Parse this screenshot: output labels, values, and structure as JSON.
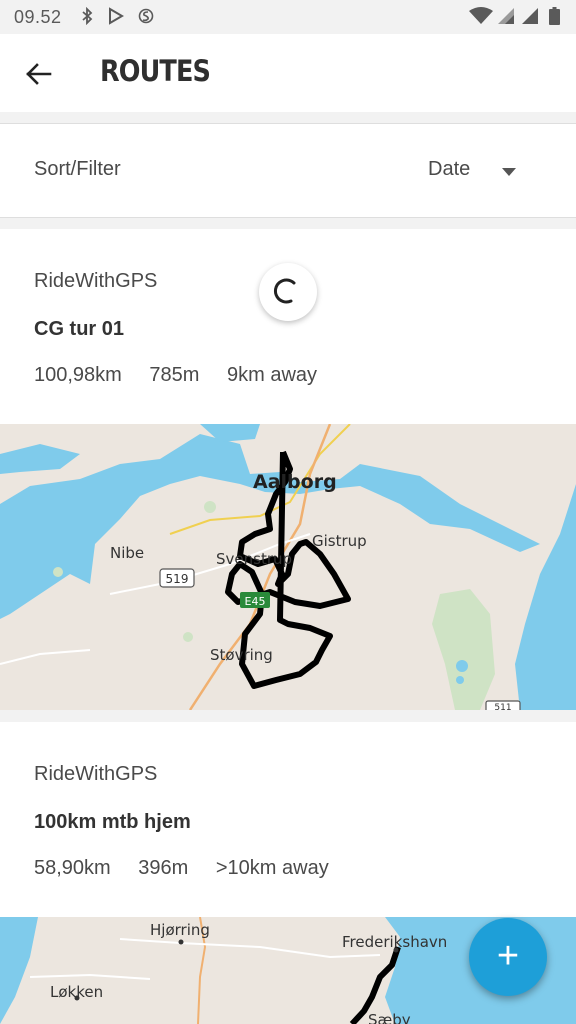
{
  "status_bar": {
    "time": "09.52",
    "icons": [
      "bluetooth-icon",
      "play-store-icon",
      "sync-icon",
      "wifi-icon",
      "signal-icon",
      "signal-icon-2",
      "battery-icon"
    ]
  },
  "app_bar": {
    "title": "ROUTES",
    "back_icon": "arrow-left-icon"
  },
  "sort_filter": {
    "label": "Sort/Filter",
    "selected": "Date"
  },
  "routes": [
    {
      "source": "RideWithGPS",
      "name": "CG tur 01",
      "distance": "100,98km",
      "elevation": "785m",
      "proximity": "9km away",
      "map_labels": [
        "Aalborg",
        "Gistrup",
        "Nibe",
        "Svenstrup",
        "Støvring",
        "519",
        "E45",
        "511"
      ]
    },
    {
      "source": "RideWithGPS",
      "name": "100km mtb hjem",
      "distance": "58,90km",
      "elevation": "396m",
      "proximity": ">10km away",
      "map_labels": [
        "Hjørring",
        "Frederikshavn",
        "Løkken",
        "Sæby"
      ]
    }
  ],
  "fab": {
    "label": "+",
    "icon": "plus-icon"
  },
  "colors": {
    "accent": "#1e9fd8",
    "water": "#7fcbeb",
    "land": "#ece6df",
    "route": "#000000"
  }
}
